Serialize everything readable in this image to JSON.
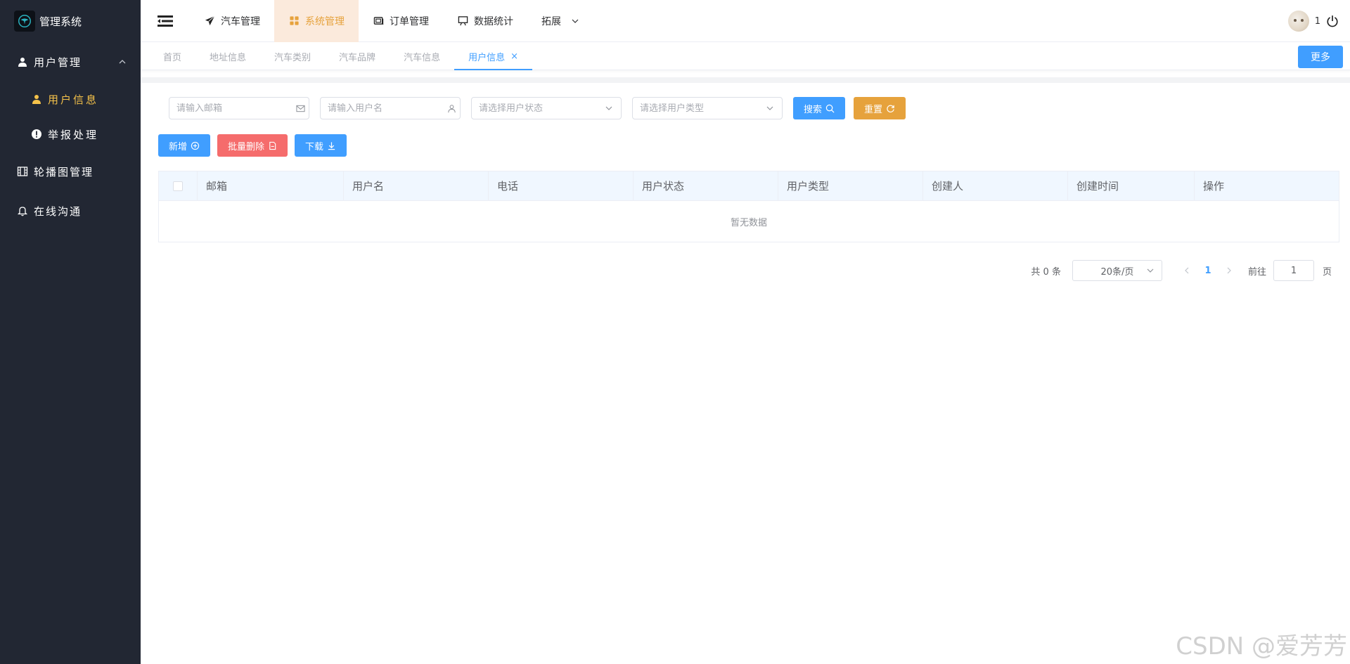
{
  "app": {
    "title": "管理系统"
  },
  "sidebar": {
    "items": [
      {
        "label": "用户管理",
        "icon": "user-icon",
        "expanded": true,
        "children": [
          {
            "label": "用户信息",
            "icon": "user-icon",
            "active": true
          },
          {
            "label": "举报处理",
            "icon": "alert-icon",
            "active": false
          }
        ]
      },
      {
        "label": "轮播图管理",
        "icon": "film-icon"
      },
      {
        "label": "在线沟通",
        "icon": "bell-icon"
      }
    ]
  },
  "topnav": {
    "items": [
      {
        "label": "汽车管理",
        "icon": "send-icon"
      },
      {
        "label": "系统管理",
        "icon": "grid-icon",
        "active": true
      },
      {
        "label": "订单管理",
        "icon": "ticket-icon"
      },
      {
        "label": "数据统计",
        "icon": "presentation-icon"
      },
      {
        "label": "拓展",
        "icon": "chevron-down-icon"
      }
    ]
  },
  "header": {
    "user_count": "1"
  },
  "tabs": {
    "items": [
      {
        "label": "首页"
      },
      {
        "label": "地址信息"
      },
      {
        "label": "汽车类别"
      },
      {
        "label": "汽车品牌"
      },
      {
        "label": "汽车信息"
      },
      {
        "label": "用户信息",
        "active": true,
        "closable": "×"
      }
    ],
    "more_label": "更多"
  },
  "filters": {
    "email_placeholder": "请输入邮箱",
    "username_placeholder": "请输入用户名",
    "status_placeholder": "请选择用户状态",
    "type_placeholder": "请选择用户类型",
    "search_label": "搜索",
    "reset_label": "重置"
  },
  "actions": {
    "add_label": "新增",
    "batch_delete_label": "批量删除",
    "download_label": "下载"
  },
  "table": {
    "columns": [
      "邮箱",
      "用户名",
      "电话",
      "用户状态",
      "用户类型",
      "创建人",
      "创建时间",
      "操作"
    ],
    "empty_text": "暂无数据"
  },
  "pagination": {
    "total_text": "共 0 条",
    "page_size": "20条/页",
    "current_page": "1",
    "goto_label": "前往",
    "goto_value": "1",
    "page_suffix": "页"
  },
  "watermark": "CSDN @爱芳芳",
  "colors": {
    "sidebar_bg": "#222733",
    "primary": "#409eff",
    "warning": "#e6a23c",
    "danger": "#f56c6c",
    "active_menu": "#f5c24a"
  }
}
